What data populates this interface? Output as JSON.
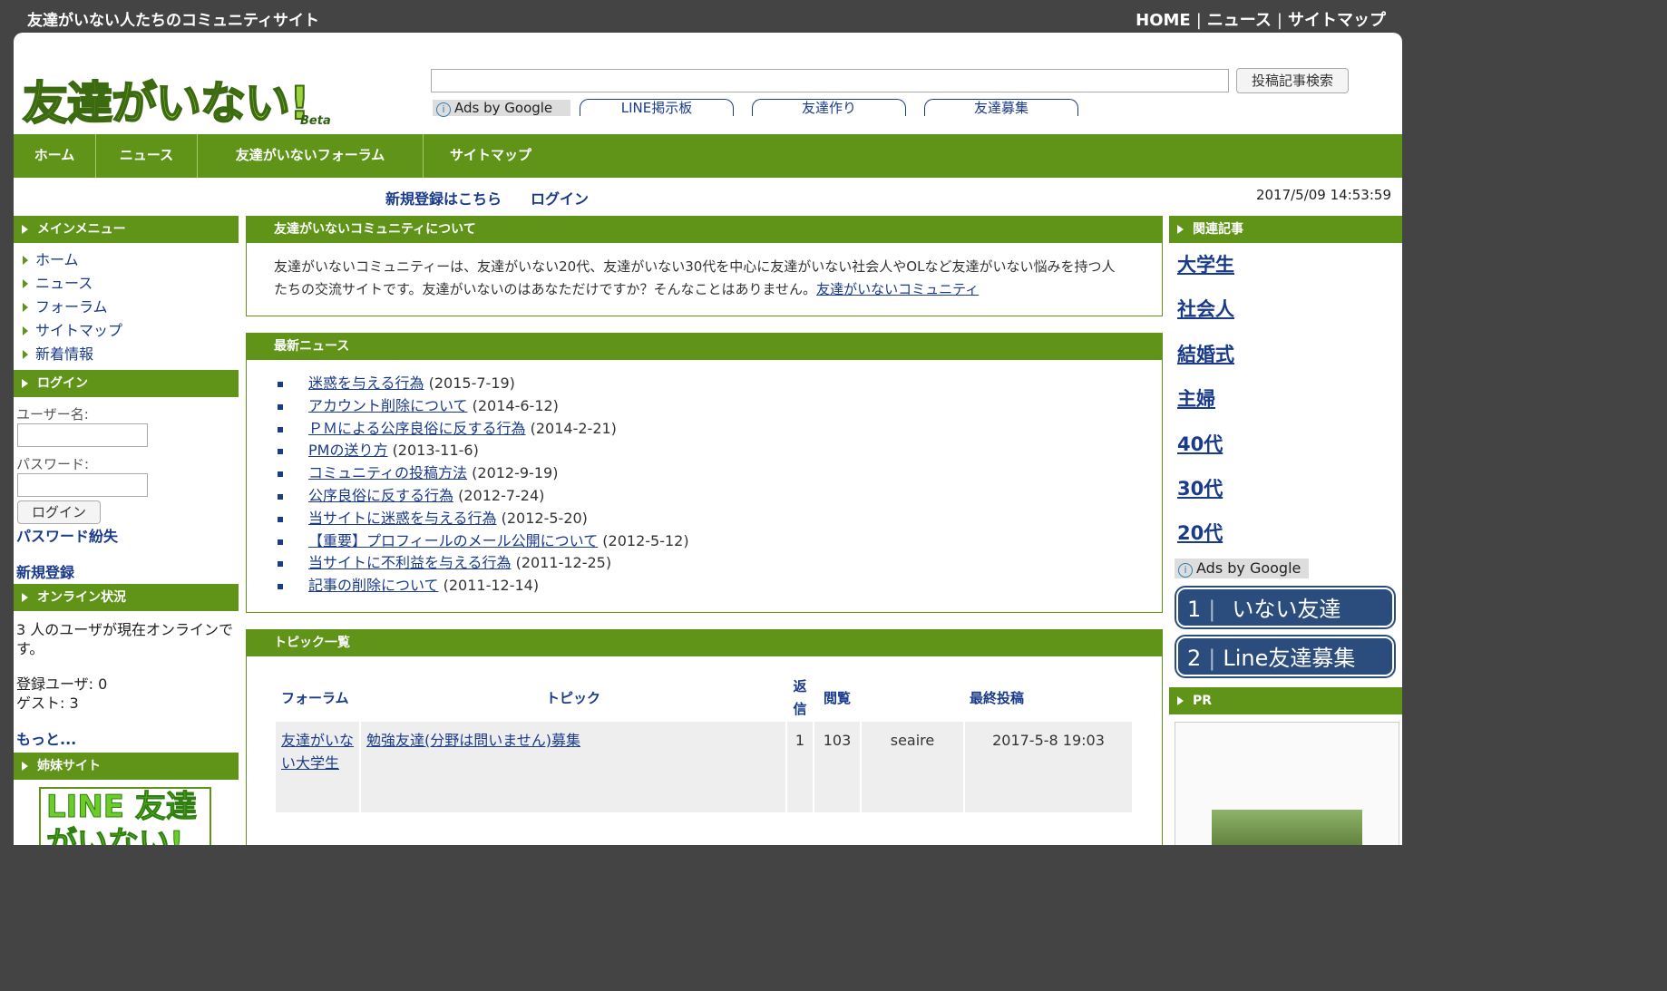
{
  "topbar": {
    "site_title": "友達がいない人たちのコミュニティサイト",
    "links": [
      "HOME",
      "ニュース",
      "サイトマップ"
    ],
    "separator": "|"
  },
  "logo": {
    "text": "友達がいない!",
    "beta": "Beta"
  },
  "search": {
    "value": "",
    "button_label": "投稿記事検索"
  },
  "ads": {
    "badge": "Ads by Google",
    "links": [
      "LINE掲示板",
      "友達作り",
      "友達募集"
    ]
  },
  "nav": [
    "ホーム",
    "ニュース",
    "友達がいないフォーラム",
    "サイトマップ"
  ],
  "subbar": {
    "register": "新規登録はこちら",
    "login": "ログイン",
    "datetime": "2017/5/09 14:53:59"
  },
  "left": {
    "main_menu_title": "メインメニュー",
    "main_menu": [
      "ホーム",
      "ニュース",
      "フォーラム",
      "サイトマップ",
      "新着情報"
    ],
    "login_title": "ログイン",
    "username_label": "ユーザー名:",
    "password_label": "パスワード:",
    "login_button": "ログイン",
    "lost_password": "パスワード紛失",
    "register": "新規登録",
    "online_title": "オンライン状況",
    "online_text": "3 人のユーザが現在オンラインです。",
    "registered_users": "登録ユーザ: 0",
    "guests": "ゲスト: 3",
    "more": "もっと...",
    "sister_title": "姉妹サイト",
    "sister_logo_text": "LINE 友達がいない!"
  },
  "center": {
    "about_title": "友達がいないコミュニティについて",
    "about_text": "友達がいないコミュニティーは、友達がいない20代、友達がいない30代を中心に友達がいない社会人やOLなど友達がいない悩みを持つ人たちの交流サイトです。友達がいないのはあなただけですか？そんなことはありません。",
    "about_link": "友達がいないコミュニティ",
    "news_title": "最新ニュース",
    "news": [
      {
        "title": "迷惑を与える行為",
        "date": "(2015-7-19)"
      },
      {
        "title": "アカウント削除について",
        "date": "(2014-6-12)"
      },
      {
        "title": "ＰＭによる公序良俗に反する行為",
        "date": "(2014-2-21)"
      },
      {
        "title": "PMの送り方",
        "date": "(2013-11-6)"
      },
      {
        "title": "コミュニティの投稿方法",
        "date": "(2012-9-19)"
      },
      {
        "title": "公序良俗に反する行為",
        "date": "(2012-7-24)"
      },
      {
        "title": "当サイトに迷惑を与える行為",
        "date": "(2012-5-20)"
      },
      {
        "title": "【重要】プロフィールのメール公開について",
        "date": "(2012-5-12)"
      },
      {
        "title": "当サイトに不利益を与える行為",
        "date": "(2011-12-25)"
      },
      {
        "title": "記事の削除について",
        "date": "(2011-12-14)"
      }
    ],
    "topics_title": "トピック一覧",
    "topic_headers": [
      "フォーラム",
      "トピック",
      "返信",
      "閲覧",
      "最終投稿"
    ],
    "topics": [
      {
        "forum": "友達がいない大学生",
        "topic": "勉強友達(分野は問いません)募集",
        "replies": "1",
        "views": "103",
        "user": "seaire",
        "last_post": "2017-5-8 19:03"
      }
    ]
  },
  "right": {
    "related_title": "関連記事",
    "related": [
      "大学生",
      "社会人",
      "結婚式",
      "主婦",
      "40代",
      "30代",
      "20代"
    ],
    "ads_badge": "Ads by Google",
    "ad_buttons": [
      {
        "num": "1",
        "label": "いない友達"
      },
      {
        "num": "2",
        "label": "Line友達募集"
      }
    ],
    "pr_title": "PR"
  },
  "colors": {
    "green": "#5f9418",
    "link": "#1a3a8a",
    "topbar": "#444444",
    "ad_blue": "#2b4d7e"
  }
}
